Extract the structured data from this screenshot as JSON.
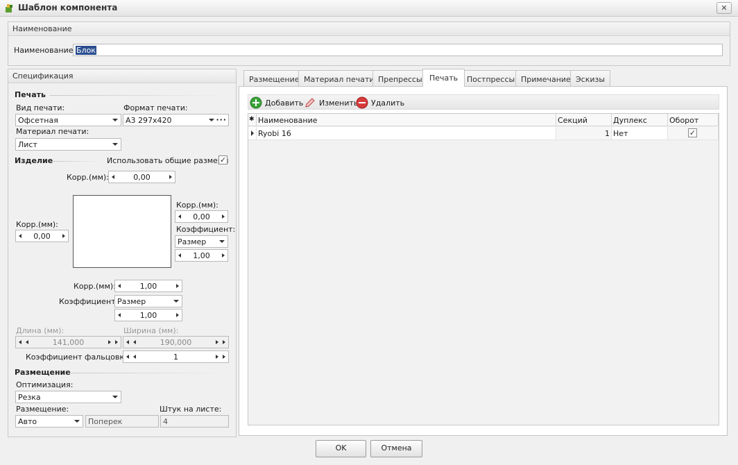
{
  "window": {
    "title": "Шаблон компонента",
    "close_glyph": "✕"
  },
  "name_group": {
    "header": "Наименование",
    "label": "Наименование:",
    "value": "Блок"
  },
  "spec": {
    "header": "Спецификация",
    "print_section": "Печать",
    "print_type_label": "Вид печати:",
    "print_type_value": "Офсетная",
    "print_format_label": "Формат печати:",
    "print_format_value": "А3 297x420",
    "format_more": "···",
    "print_material_label": "Материал печати:",
    "print_material_value": "Лист",
    "product_section": "Изделие",
    "use_common_sizes_label": "Использовать общие размеры",
    "use_common_sizes_checked": true,
    "corr_top_label": "Корр.(мм):",
    "corr_top_value": "0,00",
    "corr_left_label": "Корр.(мм):",
    "corr_left_value": "0,00",
    "corr_right_label": "Корр.(мм):",
    "corr_right_value": "0,00",
    "coef_right_label": "Коэффициент:",
    "coef_right_mode": "Размер",
    "coef_right_value": "1,00",
    "corr_bottom_label": "Корр.(мм):",
    "corr_bottom_value": "1,00",
    "coef_bottom_label": "Коэффициент:",
    "coef_bottom_mode": "Размер",
    "coef_bottom_value": "1,00",
    "length_label": "Длина (мм):",
    "length_value": "141,000",
    "width_label": "Ширина (мм):",
    "width_value": "190,000",
    "fold_coef_label": "Коэффициент фальцовки:",
    "fold_coef_value": "1",
    "placement_section": "Размещение",
    "optimization_label": "Оптимизация:",
    "optimization_value": "Резка",
    "placement_label": "Размещение:",
    "placement_value": "Авто",
    "orientation_value": "Поперек",
    "per_sheet_label": "Штук на листе:",
    "per_sheet_value": "4"
  },
  "tabs": [
    {
      "label": "Размещение",
      "active": false
    },
    {
      "label": "Материал печати",
      "active": false
    },
    {
      "label": "Препрессы",
      "active": false
    },
    {
      "label": "Печать",
      "active": true
    },
    {
      "label": "Постпрессы",
      "active": false
    },
    {
      "label": "Примечание",
      "active": false
    },
    {
      "label": "Эскизы",
      "active": false
    }
  ],
  "toolbar": {
    "add": "Добавить",
    "edit": "Изменить",
    "delete": "Удалить"
  },
  "grid": {
    "new_row_marker": "✱",
    "columns": [
      "Наименование",
      "Секций",
      "Дуплекс",
      "Оборот"
    ],
    "rows": [
      {
        "name": "Ryobi 16",
        "sections": "1",
        "duplex": "Нет",
        "turn_checked": true
      }
    ]
  },
  "buttons": {
    "ok": "OK",
    "cancel": "Отмена"
  },
  "colors": {
    "accent_add": "#3aa23a",
    "accent_delete": "#d83a3a",
    "selection": "#2b4f91"
  }
}
